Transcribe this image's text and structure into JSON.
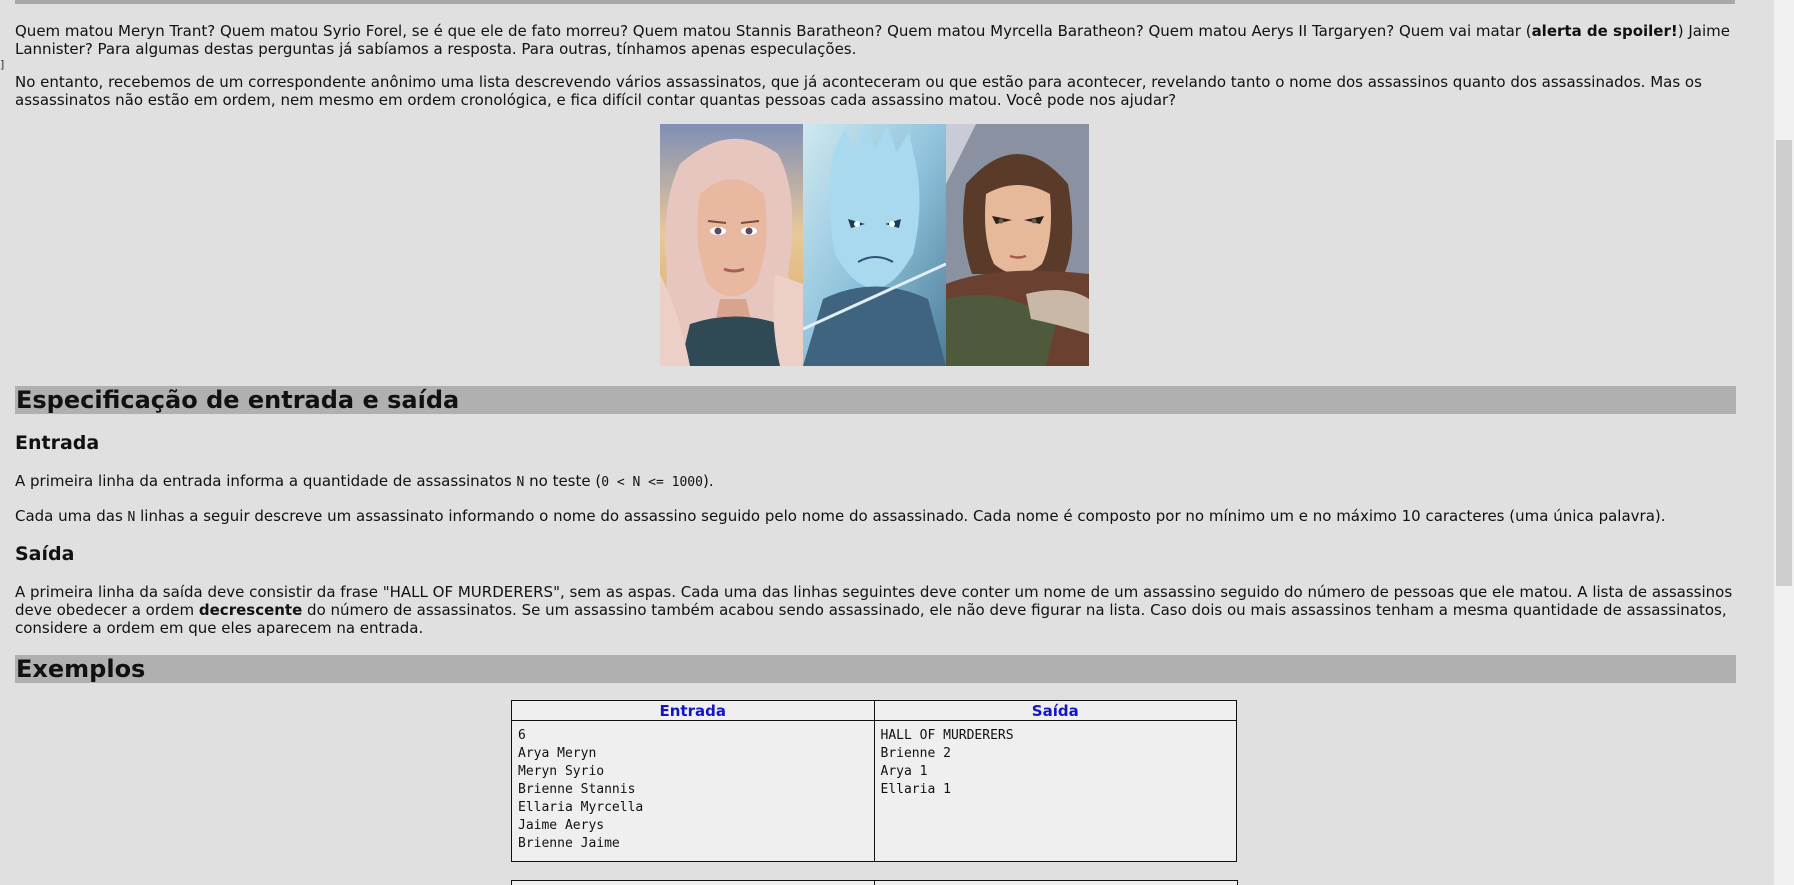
{
  "margin_mark": "]",
  "intro": {
    "p1_before_bold": "Quem matou Meryn Trant? Quem matou Syrio Forel, se é que ele de fato morreu? Quem matou Stannis Baratheon? Quem matou Myrcella Baratheon? Quem matou Aerys II Targaryen? Quem vai matar (",
    "p1_bold": "alerta de spoiler!",
    "p1_after_bold": ") Jaime Lannister? Para algumas destas perguntas já sabíamos a resposta. Para outras, tínhamos apenas especulações.",
    "p2": "No entanto, recebemos de um correspondente anônimo uma lista descrevendo vários assassinatos, que já aconteceram ou que estão para acontecer, revelando tanto o nome dos assassinos quanto dos assassinados. Mas os assassinatos não estão em ordem, nem mesmo em ordem cronológica, e fica difícil contar quantas pessoas cada assassino matou. Você pode nos ajudar?"
  },
  "spec": {
    "title": "Especificação de entrada e saída",
    "input_heading": "Entrada",
    "input_p1_a": "A primeira linha da entrada informa a quantidade de assassinatos ",
    "input_p1_code1": "N",
    "input_p1_b": " no teste (",
    "input_p1_code2": "0 < N <= 1000",
    "input_p1_c": ").",
    "input_p2_a": "Cada uma das ",
    "input_p2_code": "N",
    "input_p2_b": " linhas a seguir descreve um assassinato informando o nome do assassino seguido pelo nome do assassinado. Cada nome é composto por no mínimo um e no máximo 10 caracteres (uma única palavra).",
    "output_heading": "Saída",
    "output_p_a": "A primeira linha da saída deve consistir da frase \"HALL OF MURDERERS\", sem as aspas. Cada uma das linhas seguintes deve conter um nome de um assassino seguido do número de pessoas que ele matou. A lista de assassinos deve obedecer a ordem ",
    "output_p_bold": "decrescente",
    "output_p_b": " do número de assassinatos. Se um assassino também acabou sendo assassinado, ele não deve figurar na lista. Caso dois ou mais assassinos tenham a mesma quantidade de assassinatos, considere a ordem em que eles aparecem na entrada."
  },
  "examples": {
    "title": "Exemplos",
    "header_input": "Entrada",
    "header_output": "Saída",
    "input_text": "6\nArya Meryn\nMeryn Syrio\nBrienne Stannis\nEllaria Myrcella\nJaime Aerys\nBrienne Jaime",
    "output_text": "HALL OF MURDERERS\nBrienne 2\nArya 1\nEllaria 1"
  },
  "colors": {
    "background": "#e0e0e0",
    "section_bar": "#b0b0b0",
    "table_header_text": "#1515c8"
  }
}
